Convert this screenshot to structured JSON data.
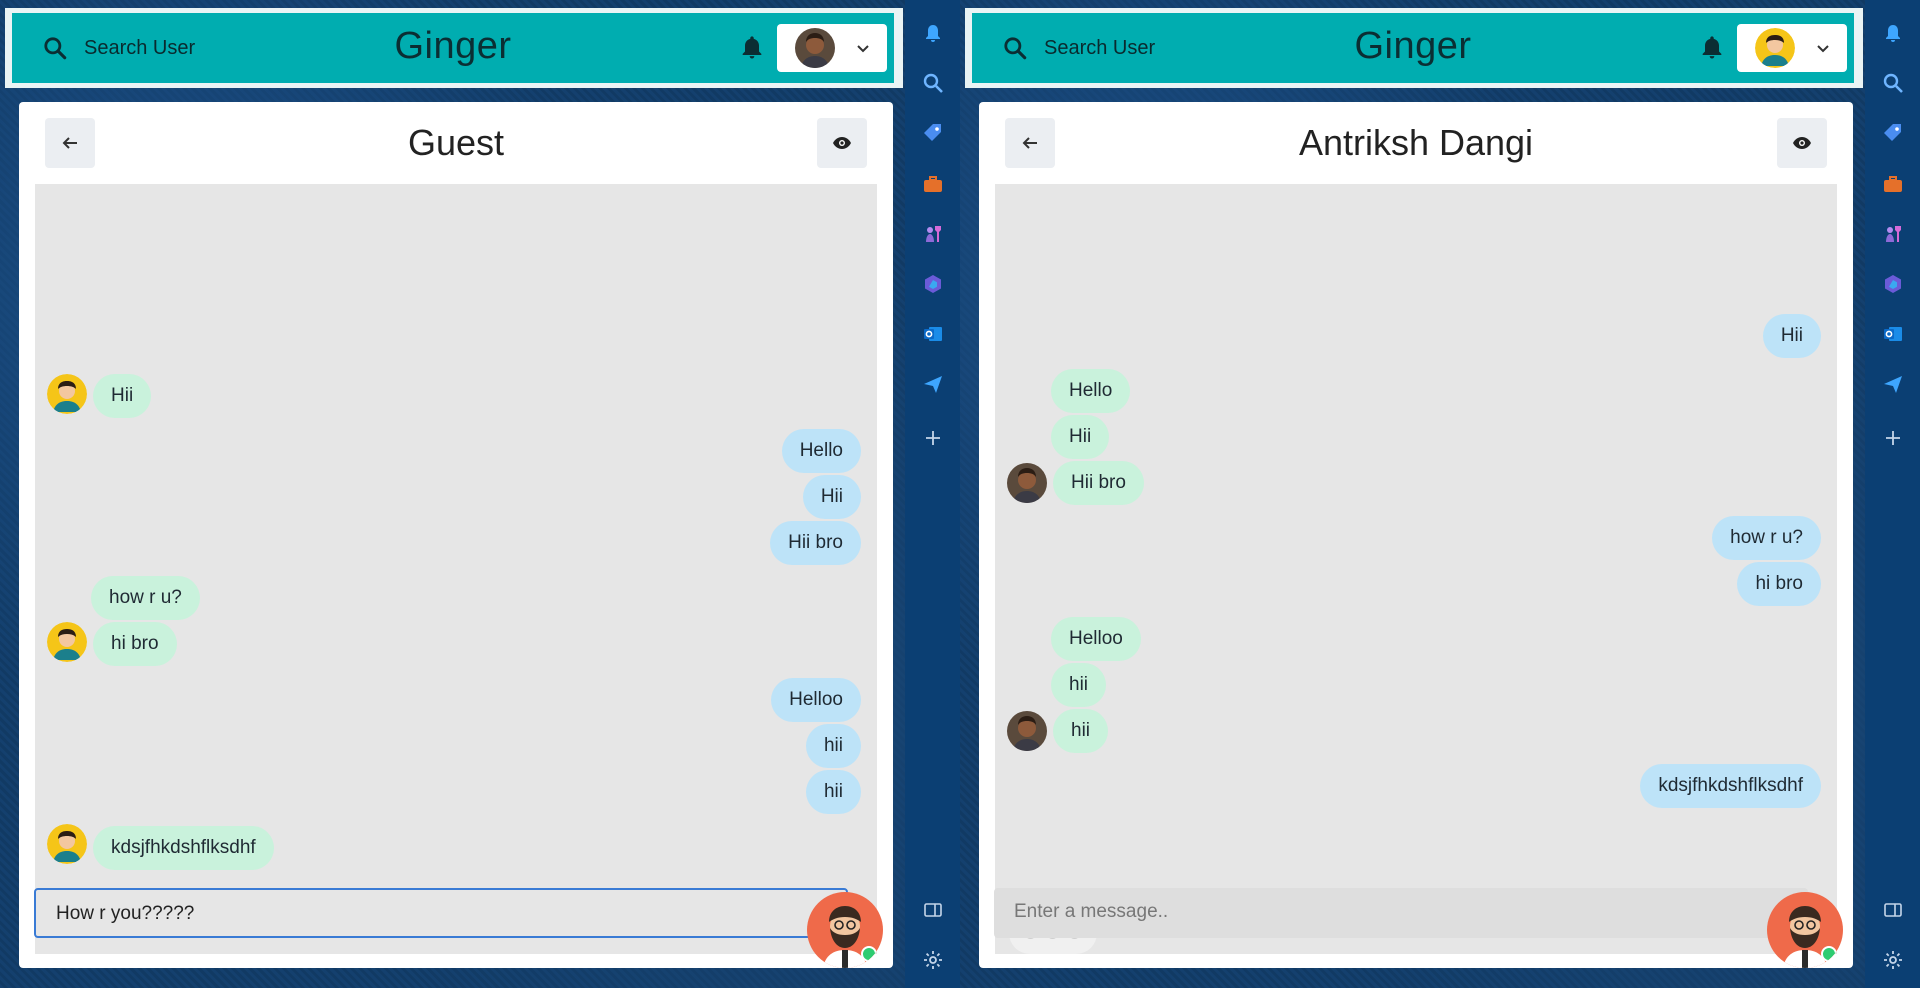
{
  "left": {
    "search": {
      "label": "Search User"
    },
    "brand": "Ginger",
    "chat_title": "Guest",
    "messages": [
      {
        "text": "Hii",
        "dir": "in",
        "avatar": true
      },
      {
        "text": "Hello",
        "dir": "out"
      },
      {
        "text": "Hii",
        "dir": "out"
      },
      {
        "text": "Hii bro",
        "dir": "out"
      },
      {
        "text": "how r u?",
        "dir": "in"
      },
      {
        "text": "hi bro",
        "dir": "in",
        "avatar": true
      },
      {
        "text": "Helloo",
        "dir": "out"
      },
      {
        "text": "hii",
        "dir": "out"
      },
      {
        "text": "hii",
        "dir": "out"
      },
      {
        "text": "kdsjfhkdshflksdhf",
        "dir": "in",
        "avatar": true
      }
    ],
    "composer": {
      "value": "How r you?????",
      "placeholder": "Enter a message.."
    }
  },
  "right": {
    "search": {
      "label": "Search User"
    },
    "brand": "Ginger",
    "chat_title": "Antriksh Dangi",
    "messages": [
      {
        "text": "Hii",
        "dir": "out"
      },
      {
        "text": "Hello",
        "dir": "in"
      },
      {
        "text": "Hii",
        "dir": "in"
      },
      {
        "text": "Hii bro",
        "dir": "in",
        "avatar": true
      },
      {
        "text": "how r u?",
        "dir": "out"
      },
      {
        "text": "hi bro",
        "dir": "out"
      },
      {
        "text": "Helloo",
        "dir": "in"
      },
      {
        "text": "hii",
        "dir": "in"
      },
      {
        "text": "hii",
        "dir": "in",
        "avatar": true
      },
      {
        "text": "kdsjfhkdshflksdhf",
        "dir": "out"
      }
    ],
    "composer": {
      "value": "",
      "placeholder": "Enter a message.."
    }
  },
  "sidebar_icons": [
    "bell-icon",
    "search-icon",
    "tag-icon",
    "briefcase-icon",
    "chess-icon",
    "copilot-icon",
    "outlook-icon",
    "send-icon",
    "plus-icon",
    "panel-icon",
    "gear-icon"
  ],
  "colors": {
    "topbar": "#00adb0",
    "incoming": "#c9f2dc",
    "outgoing": "#bde3f8",
    "sidebar": "#0b3f73",
    "fab": "#ef6a4a"
  }
}
